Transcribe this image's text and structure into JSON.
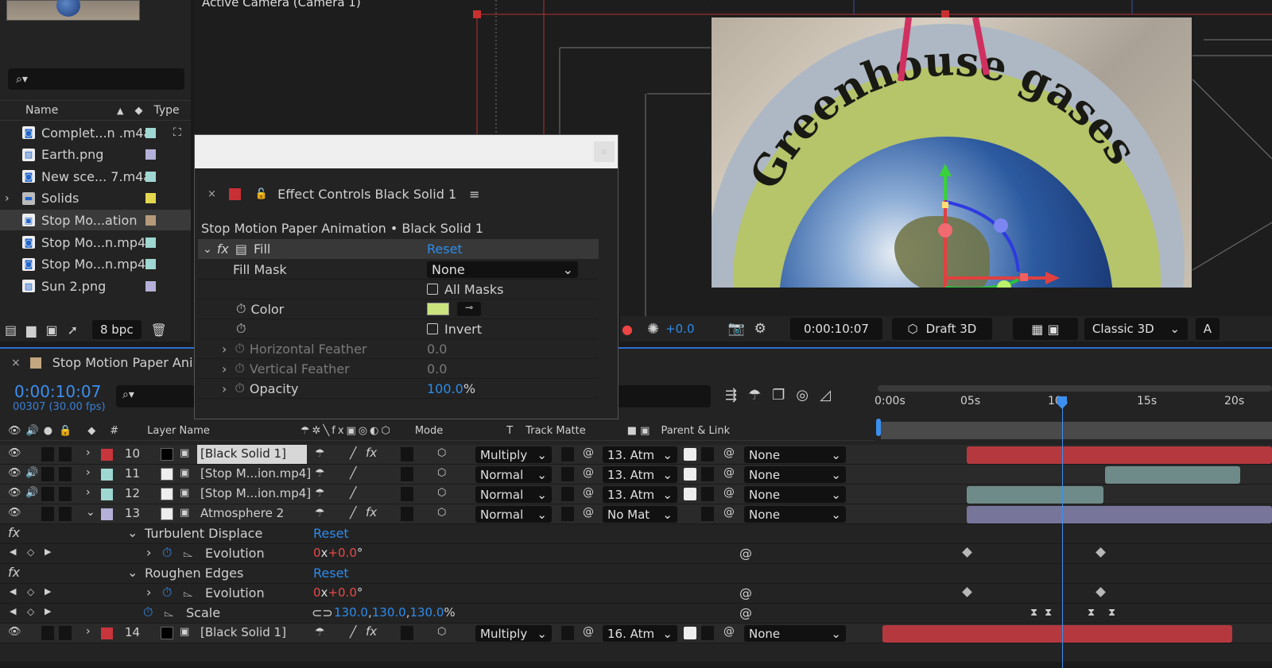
{
  "viewer": {
    "title": "Active Camera (Camera 1)",
    "arc_text": "Greenhouse gases"
  },
  "project": {
    "search_placeholder": "",
    "col_name": "Name",
    "col_type": "Type",
    "items": [
      {
        "name": "Complet...n .m4a",
        "color": "#9fd7d2",
        "kind": "audio"
      },
      {
        "name": "Earth.png",
        "color": "#b4b0da",
        "kind": "image"
      },
      {
        "name": "New sce... 7.m4a",
        "color": "#9fd7d2",
        "kind": "audio"
      },
      {
        "name": "Solids",
        "color": "#e3d74e",
        "kind": "folder"
      },
      {
        "name": "Stop Mo...ation",
        "color": "#b59a7a",
        "kind": "comp"
      },
      {
        "name": "Stop Mo...n.mp4",
        "color": "#9fd7d2",
        "kind": "video"
      },
      {
        "name": "Stop Mo...n.mp4",
        "color": "#9fd7d2",
        "kind": "video"
      },
      {
        "name": "Sun 2.png",
        "color": "#b4b0da",
        "kind": "image"
      }
    ],
    "bpc": "8 bpc"
  },
  "viewer_bar": {
    "exposure": "+0.0",
    "timecode": "0:00:10:07",
    "renderer": "Draft 3D",
    "view": "Classic 3D",
    "extra": "A"
  },
  "effect_controls": {
    "tab": "Effect Controls Black Solid 1",
    "subtitle": "Stop Motion Paper Animation • Black Solid 1",
    "effect": "Fill",
    "reset": "Reset",
    "fill_mask_label": "Fill Mask",
    "fill_mask_value": "None",
    "all_masks": "All Masks",
    "color_label": "Color",
    "color_value": "#cbe47e",
    "invert": "Invert",
    "hfeather_label": "Horizontal Feather",
    "hfeather_value": "0.0",
    "vfeather_label": "Vertical Feather",
    "vfeather_value": "0.0",
    "opacity_label": "Opacity",
    "opacity_value": "100.0",
    "opacity_unit": "%"
  },
  "timeline": {
    "comp_tab": "Stop Motion Paper Anim",
    "time": "0:00:10:07",
    "frames": "00307 (30.00 fps)",
    "headers": {
      "num": "#",
      "layer_name": "Layer Name",
      "mode": "Mode",
      "t": "T",
      "track_matte": "Track Matte",
      "parent": "Parent & Link"
    },
    "ruler": [
      "0:00s",
      "05s",
      "10s",
      "15s",
      "20s"
    ],
    "layers": [
      {
        "num": "10",
        "name": "[Black Solid 1]",
        "color": "#c8353b",
        "mode": "Multiply",
        "matte": "13. Atm",
        "parent": "None"
      },
      {
        "num": "11",
        "name": "[Stop M...ion.mp4]",
        "color": "#9fd7d2",
        "mode": "Normal",
        "matte": "13. Atm",
        "parent": "None"
      },
      {
        "num": "12",
        "name": "[Stop M...ion.mp4]",
        "color": "#9fd7d2",
        "mode": "Normal",
        "matte": "13. Atm",
        "parent": "None"
      },
      {
        "num": "13",
        "name": "Atmosphere 2",
        "color": "#b4b0da",
        "mode": "Normal",
        "matte": "No Mat",
        "parent": "None"
      },
      {
        "num": "14",
        "name": "[Black Solid 1]",
        "color": "#c8353b",
        "mode": "Multiply",
        "matte": "16. Atm",
        "parent": "None"
      }
    ],
    "turb": {
      "name": "Turbulent Displace",
      "reset": "Reset",
      "prop": "Evolution",
      "v1": "0",
      "x": "x",
      "v2": "+0.0",
      "deg": "°"
    },
    "rough": {
      "name": "Roughen Edges",
      "reset": "Reset",
      "prop": "Evolution",
      "v1": "0",
      "x": "x",
      "v2": "+0.0",
      "deg": "°"
    },
    "scale": {
      "name": "Scale",
      "v1": "130.0",
      "v2": "130.0",
      "v3": "130.0",
      "unit": "%",
      "sep": ","
    }
  }
}
